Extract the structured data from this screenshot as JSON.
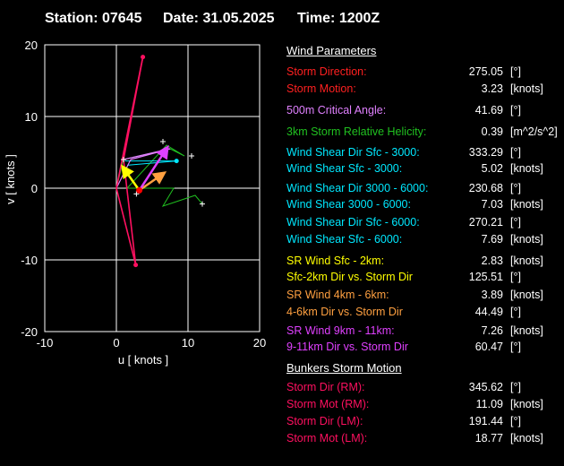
{
  "header": {
    "station": "Station: 07645",
    "date": "Date: 31.05.2025",
    "time": "Time: 1200Z"
  },
  "colors": {
    "background": "#000000",
    "red": "#ff0000",
    "violet": "#e080ff",
    "green": "#20c020",
    "cyan": "#00e8ff",
    "yellow": "#ffff00",
    "orange": "#ffa040",
    "magenta": "#e040ff",
    "pink": "#ff1060",
    "white": "#ffffff"
  },
  "wind_parameters": {
    "title": "Wind Parameters",
    "rows": [
      {
        "label": "Storm Direction:",
        "value": "275.05",
        "unit": "[°]",
        "color": "#ff2020"
      },
      {
        "label": "Storm Motion:",
        "value": "3.23",
        "unit": "[knots]",
        "color": "#ff2020"
      },
      {
        "label": "500m Critical Angle:",
        "value": "41.69",
        "unit": "[°]",
        "color": "#e080ff"
      },
      {
        "label": "3km Storm Relative Helicity:",
        "value": "0.39",
        "unit": "[m^2/s^2]",
        "color": "#20c020"
      },
      {
        "label": "Wind Shear Dir Sfc - 3000:",
        "value": "333.29",
        "unit": "[°]",
        "color": "#00e8ff"
      },
      {
        "label": "Wind Shear Sfc - 3000:",
        "value": "5.02",
        "unit": "[knots]",
        "color": "#00e8ff"
      },
      {
        "label": "Wind Shear Dir 3000 - 6000:",
        "value": "230.68",
        "unit": "[°]",
        "color": "#00e8ff"
      },
      {
        "label": "Wind Shear 3000 - 6000:",
        "value": "7.03",
        "unit": "[knots]",
        "color": "#00e8ff"
      },
      {
        "label": "Wind Shear Dir Sfc - 6000:",
        "value": "270.21",
        "unit": "[°]",
        "color": "#00e8ff"
      },
      {
        "label": "Wind Shear Sfc - 6000:",
        "value": "7.69",
        "unit": "[knots]",
        "color": "#00e8ff"
      },
      {
        "label": "SR Wind Sfc - 2km:",
        "value": "2.83",
        "unit": "[knots]",
        "color": "#ffff00"
      },
      {
        "label": "Sfc-2km Dir vs. Storm Dir",
        "value": "125.51",
        "unit": "[°]",
        "color": "#ffff00"
      },
      {
        "label": "SR Wind 4km - 6km:",
        "value": "3.89",
        "unit": "[knots]",
        "color": "#ffa040"
      },
      {
        "label": "4-6km Dir vs. Storm Dir",
        "value": "44.49",
        "unit": "[°]",
        "color": "#ffa040"
      },
      {
        "label": "SR Wind 9km - 11km:",
        "value": "7.26",
        "unit": "[knots]",
        "color": "#e040ff"
      },
      {
        "label": "9-11km Dir vs. Storm Dir",
        "value": "60.47",
        "unit": "[°]",
        "color": "#e040ff"
      }
    ]
  },
  "bunkers": {
    "title": "Bunkers Storm Motion",
    "rows": [
      {
        "label": "Storm Dir (RM):",
        "value": "345.62",
        "unit": "[°]",
        "color": "#ff1060"
      },
      {
        "label": "Storm Mot (RM):",
        "value": "11.09",
        "unit": "[knots]",
        "color": "#ff1060"
      },
      {
        "label": "Storm Dir (LM):",
        "value": "191.44",
        "unit": "[°]",
        "color": "#ff1060"
      },
      {
        "label": "Storm Mot (LM):",
        "value": "18.77",
        "unit": "[knots]",
        "color": "#ff1060"
      }
    ]
  },
  "chart_data": {
    "type": "scatter",
    "xlabel": "u  [ knots ]",
    "ylabel": "v  [ knots ]",
    "xlim": [
      -10,
      20
    ],
    "ylim": [
      -20,
      20
    ],
    "xticks": [
      "-10",
      "0",
      "10",
      "20"
    ],
    "yticks": [
      "20",
      "10",
      "0",
      "-10",
      "-20"
    ],
    "grid": true,
    "hodograph_green": [
      [
        0.0,
        0.0
      ],
      [
        1.0,
        4.0
      ],
      [
        7.5,
        5.5
      ],
      [
        9.5,
        4.5
      ],
      [
        7.0,
        6.0
      ],
      [
        1.5,
        0.0
      ],
      [
        8.0,
        0.0
      ],
      [
        6.5,
        -2.5
      ],
      [
        11.0,
        -1.0
      ],
      [
        12.0,
        -2.2
      ]
    ],
    "hodograph_white_points": [
      [
        6.5,
        6.5
      ],
      [
        10.5,
        4.5
      ],
      [
        12.0,
        -2.2
      ],
      [
        2.8,
        -0.8
      ],
      [
        1.0,
        4.0
      ]
    ],
    "bunkers_lines": [
      {
        "from": [
          0.0,
          0.0
        ],
        "to": [
          3.7,
          18.3
        ]
      },
      {
        "from": [
          0.0,
          0.0
        ],
        "to": [
          2.7,
          -10.7
        ]
      },
      {
        "from": [
          1.0,
          4.0
        ],
        "to": [
          3.7,
          18.3
        ]
      },
      {
        "from": [
          1.0,
          4.0
        ],
        "to": [
          2.7,
          -10.7
        ]
      }
    ],
    "bunkers_points": [
      [
        3.7,
        18.3
      ],
      [
        2.7,
        -10.7
      ]
    ],
    "violet_lines": [
      {
        "from": [
          0.0,
          0.0
        ],
        "to": [
          2.0,
          4.0
        ]
      },
      {
        "from": [
          2.0,
          4.0
        ],
        "to": [
          7.5,
          5.5
        ]
      },
      {
        "from": [
          1.0,
          4.0
        ],
        "to": [
          7.5,
          5.5
        ]
      }
    ],
    "cyan_lines": [
      {
        "from": [
          1.2,
          3.8
        ],
        "to": [
          8.4,
          3.8
        ]
      },
      {
        "from": [
          1.5,
          3.2
        ],
        "to": [
          8.4,
          3.8
        ]
      }
    ],
    "storm_motion": [
      3.2,
      -0.3
    ],
    "arrows": [
      {
        "color": "#ffff00",
        "from": [
          3.2,
          -0.3
        ],
        "to": [
          1.0,
          2.8
        ]
      },
      {
        "color": "#ffa040",
        "from": [
          3.2,
          -0.3
        ],
        "to": [
          6.5,
          2.0
        ]
      },
      {
        "color": "#e040ff",
        "from": [
          3.2,
          -0.3
        ],
        "to": [
          7.0,
          5.5
        ]
      }
    ]
  }
}
